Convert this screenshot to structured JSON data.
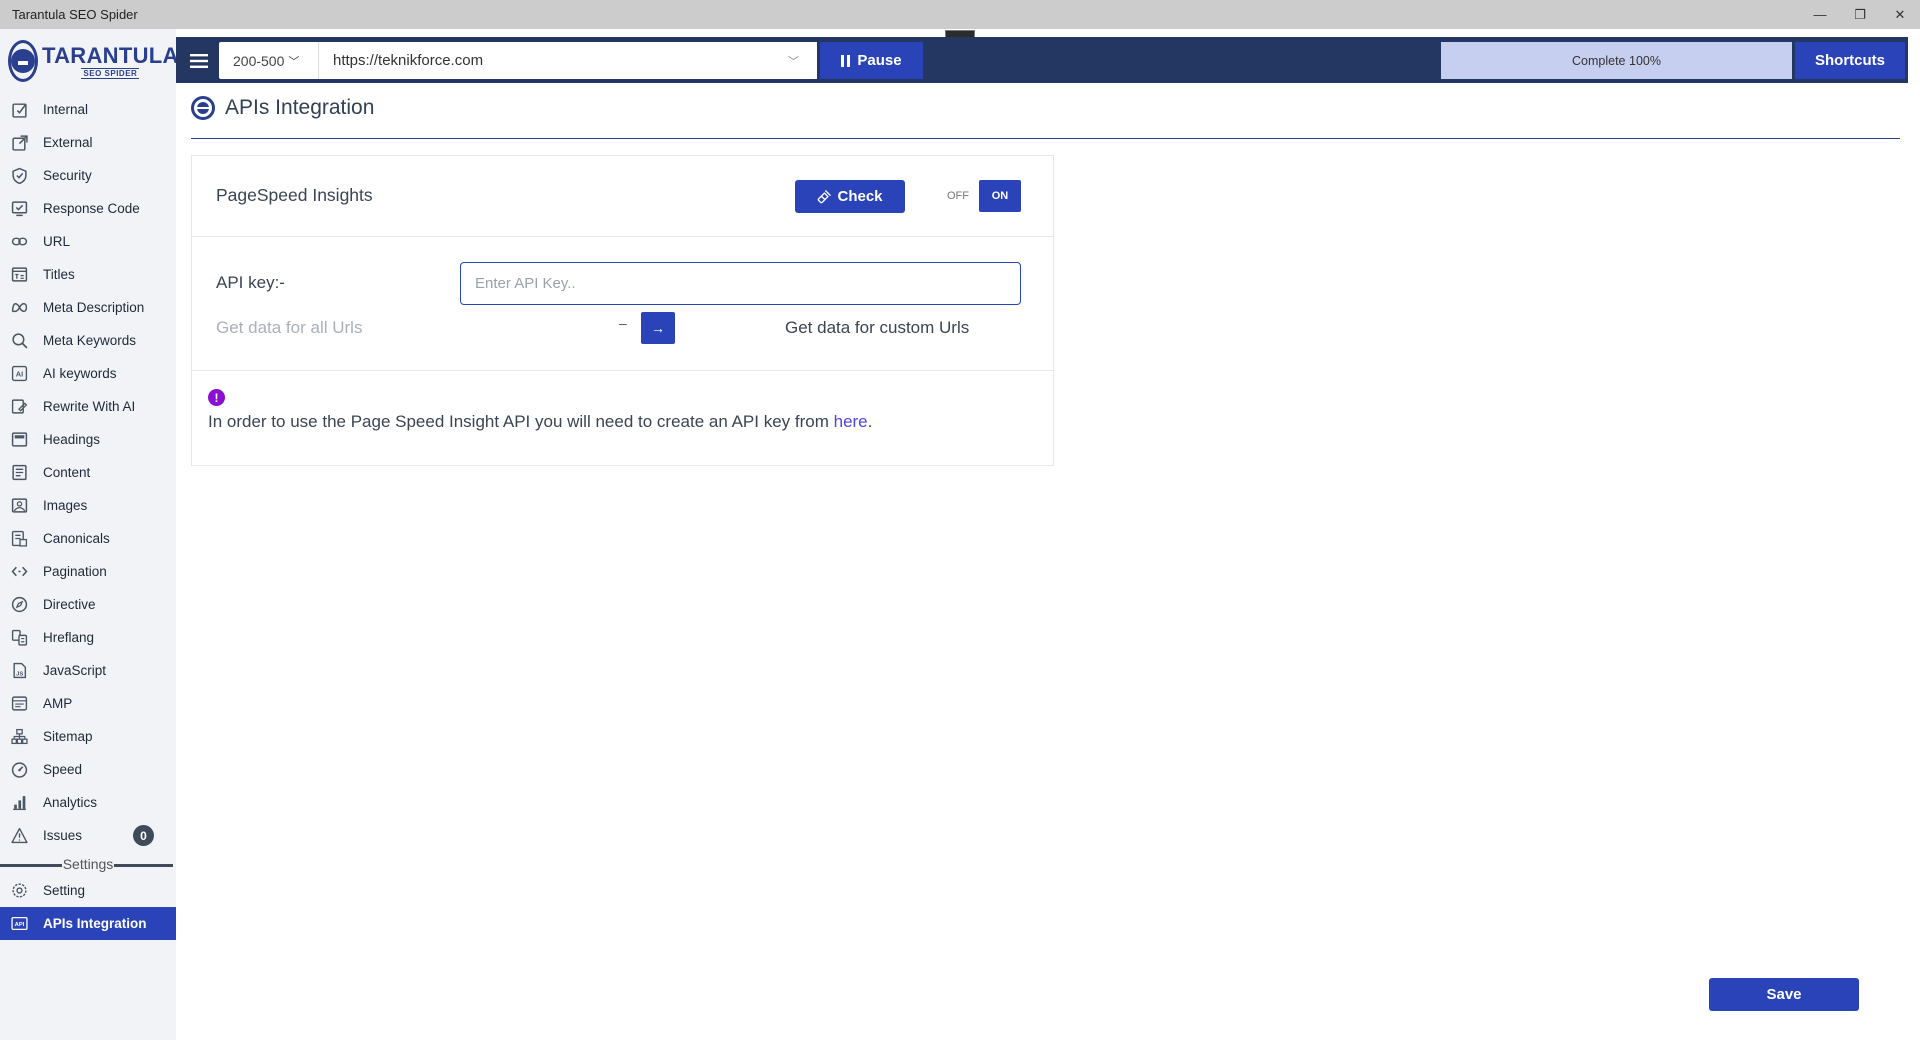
{
  "window": {
    "title": "Tarantula SEO Spider",
    "controls": [
      "—",
      "❐",
      "✕"
    ]
  },
  "brand": {
    "name": "TARANTULA",
    "sub": "SEO SPIDER"
  },
  "sidebar": {
    "items": [
      {
        "label": "Internal",
        "icon": "internal-icon"
      },
      {
        "label": "External",
        "icon": "external-link-icon"
      },
      {
        "label": "Security",
        "icon": "shield-icon"
      },
      {
        "label": "Response Code",
        "icon": "response-code-icon"
      },
      {
        "label": "URL",
        "icon": "link-icon"
      },
      {
        "label": "Titles",
        "icon": "titles-icon"
      },
      {
        "label": "Meta Description",
        "icon": "meta-icon"
      },
      {
        "label": "Meta Keywords",
        "icon": "search-icon"
      },
      {
        "label": "AI keywords",
        "icon": "ai-icon"
      },
      {
        "label": "Rewrite With AI",
        "icon": "edit-icon"
      },
      {
        "label": "Headings",
        "icon": "headings-icon"
      },
      {
        "label": "Content",
        "icon": "content-icon"
      },
      {
        "label": "Images",
        "icon": "image-icon"
      },
      {
        "label": "Canonicals",
        "icon": "canonicals-icon"
      },
      {
        "label": "Pagination",
        "icon": "code-icon"
      },
      {
        "label": "Directive",
        "icon": "compass-icon"
      },
      {
        "label": "Hreflang",
        "icon": "hreflang-icon"
      },
      {
        "label": "JavaScript",
        "icon": "javascript-icon"
      },
      {
        "label": "AMP",
        "icon": "amp-icon"
      },
      {
        "label": "Sitemap",
        "icon": "sitemap-icon"
      },
      {
        "label": "Speed",
        "icon": "speedometer-icon"
      },
      {
        "label": "Analytics",
        "icon": "analytics-icon"
      },
      {
        "label": "Issues",
        "icon": "warning-icon",
        "badge": "0"
      }
    ],
    "settings_heading": "Settings",
    "settings_items": [
      {
        "label": "Setting",
        "icon": "gear-icon"
      },
      {
        "label": "APIs Integration",
        "icon": "api-icon",
        "active": true
      }
    ]
  },
  "toolbar": {
    "range": "200-500",
    "url": "https://teknikforce.com",
    "pause_label": "Pause",
    "progress_label": "Complete 100%",
    "progress_fraction": 1.0,
    "shortcuts_label": "Shortcuts"
  },
  "page": {
    "title": "APIs Integration"
  },
  "card": {
    "service": "PageSpeed Insights",
    "check_label": "Check",
    "toggle_off": "OFF",
    "toggle_on": "ON",
    "apikey_label": "API key:-",
    "apikey_placeholder": "Enter API Key..",
    "apikey_value": "",
    "all_urls_label": "Get data for all Urls",
    "dash": "–",
    "arrow": "→",
    "custom_urls_label": "Get data for custom Urls",
    "info_icon": "!",
    "info_text": "In order to use the Page Speed Insight API you will need to create an API key from ",
    "info_link": "here",
    "info_end": "."
  },
  "save_label": "Save",
  "colors": {
    "accent": "#2b43b8",
    "toolbar": "#233762",
    "sidebar_bg": "#f1f3f7",
    "info": "#8b0fd0"
  }
}
